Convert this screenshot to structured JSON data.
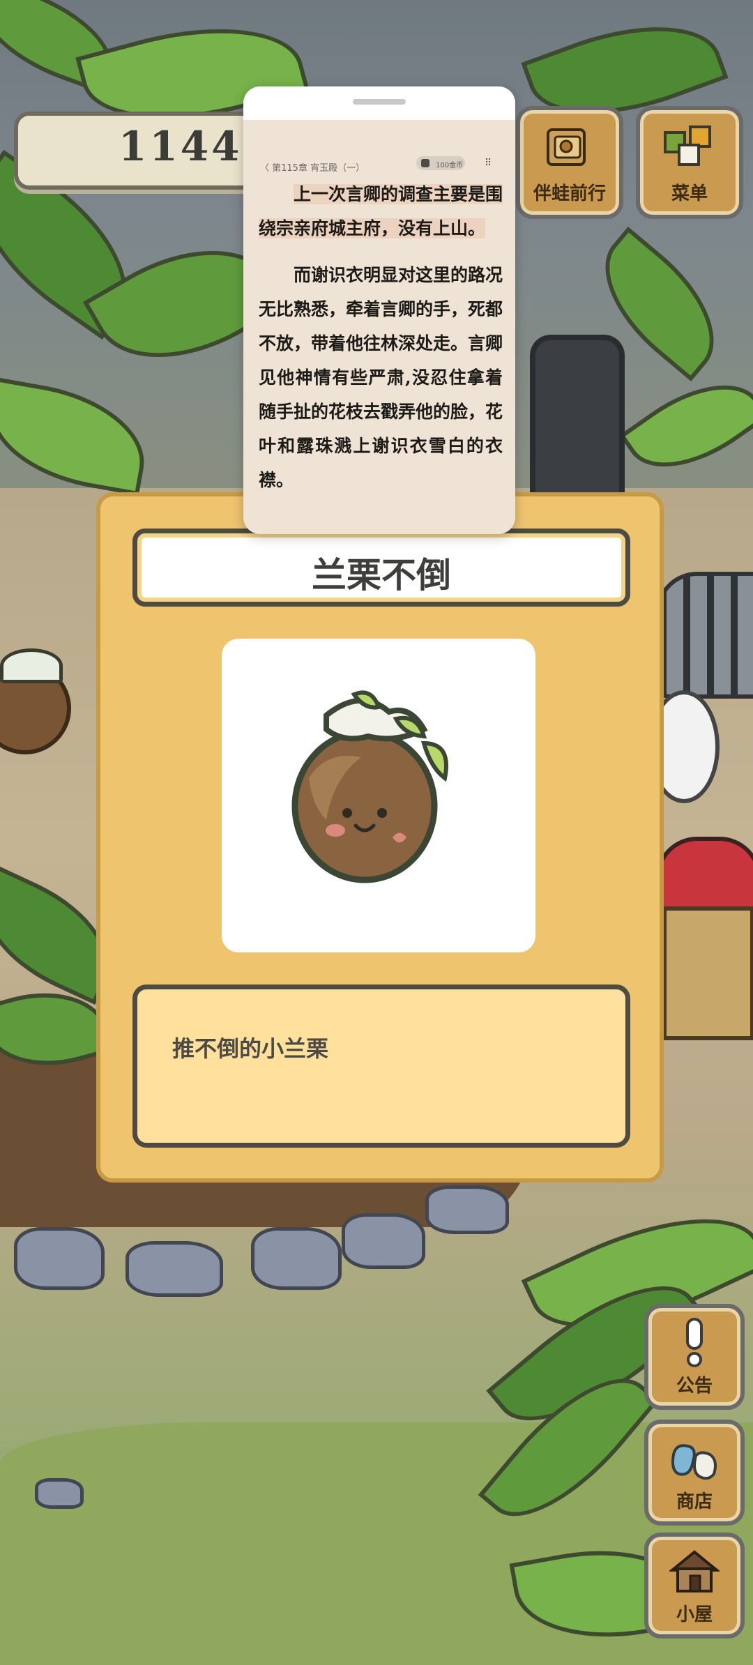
{
  "counter": {
    "value": "1144"
  },
  "top_buttons": {
    "companion": {
      "label": "伴蛙前行"
    },
    "menu": {
      "label": "菜单"
    }
  },
  "side_buttons": {
    "notice": {
      "label": "公告"
    },
    "shop": {
      "label": "商店"
    },
    "house": {
      "label": "小屋"
    }
  },
  "item_card": {
    "title": "兰栗不倒",
    "description": "推不倒的小兰栗"
  },
  "reader": {
    "chapter": "〈 第115章 宵玉殿（一）",
    "coins": "100金币",
    "paragraph_1": "上一次言卿的调查主要是围绕宗亲府城主府，没有上山。",
    "paragraph_2": "而谢识衣明显对这里的路况无比熟悉，牵着言卿的手，死都不放，带着他往林深处走。言卿见他神情有些严肃,没忍住拿着随手扯的花枝去戳弄他的脸，花叶和露珠溅上谢识衣雪白的衣襟。"
  },
  "colors": {
    "card_background": "#eec46f",
    "description_background": "#ffe09c",
    "reader_background": "#efe3d6",
    "highlight": "#ecd3bf",
    "button_wood": "#c99a4f"
  },
  "icons": [
    "chestnut-character-icon",
    "map-book-icon",
    "menu-cards-icon",
    "exclamation-icon",
    "shop-bags-icon",
    "house-icon"
  ]
}
